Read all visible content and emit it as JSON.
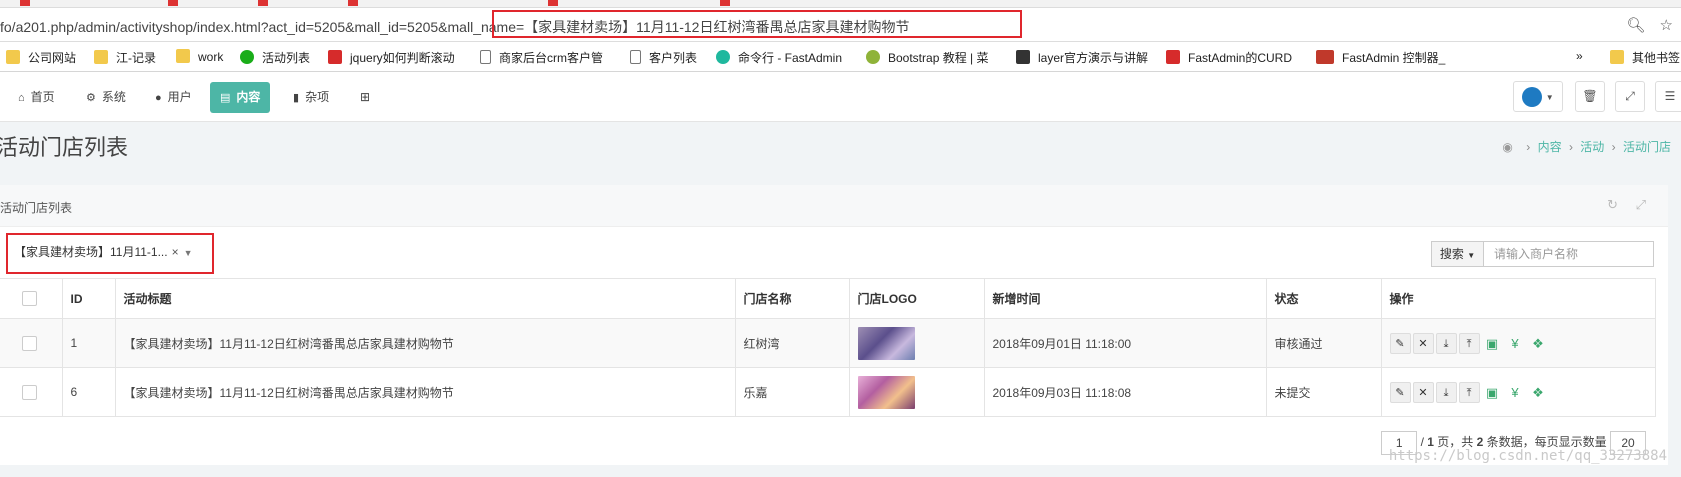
{
  "browser": {
    "url": "fo/a201.php/admin/activityshop/index.html?act_id=5205&mall_id=5205&mall_name=【家具建材卖场】11月11-12日红树湾番禺总店家具建材购物节"
  },
  "bookmarks": [
    {
      "label": "公司网站",
      "icon": "folder-icon"
    },
    {
      "label": "江-记录",
      "icon": "folder-icon"
    },
    {
      "label": "work",
      "icon": "folder-icon"
    },
    {
      "label": "活动列表",
      "icon": "green-circle-icon"
    },
    {
      "label": "jquery如何判断滚动",
      "icon": "red-logo-icon"
    },
    {
      "label": "商家后台crm客户管",
      "icon": "page-icon"
    },
    {
      "label": "客户列表",
      "icon": "page-icon"
    },
    {
      "label": "命令行 - FastAdmin",
      "icon": "teal-logo-icon"
    },
    {
      "label": "Bootstrap 教程 | 菜",
      "icon": "olive-logo-icon"
    },
    {
      "label": "layer官方演示与讲解",
      "icon": "dark-logo-icon"
    },
    {
      "label": "FastAdmin的CURD",
      "icon": "red-logo-icon"
    },
    {
      "label": "FastAdmin 控制器_",
      "icon": "w3c-logo-icon"
    },
    {
      "label": "»",
      "icon": ""
    },
    {
      "label": "其他书签",
      "icon": "folder-icon"
    }
  ],
  "nav": {
    "items": [
      {
        "label": "首页",
        "icon": "home-icon"
      },
      {
        "label": "系统",
        "icon": "gear-icon"
      },
      {
        "label": "用户",
        "icon": "user-icon"
      },
      {
        "label": "内容",
        "icon": "content-icon",
        "active": true
      },
      {
        "label": "杂项",
        "icon": "book-icon"
      }
    ]
  },
  "header": {
    "title": "活动门店列表",
    "breadcrumb": [
      "内容",
      "活动",
      "活动门店"
    ]
  },
  "panel": {
    "title": "活动门店列表",
    "filter_value": "【家具建材卖场】11月11-1...",
    "search_button": "搜索",
    "search_placeholder": "请输入商户名称"
  },
  "table": {
    "columns": [
      "ID",
      "活动标题",
      "门店名称",
      "门店LOGO",
      "新增时间",
      "状态",
      "操作"
    ],
    "rows": [
      {
        "id": "1",
        "title": "【家具建材卖场】11月11-12日红树湾番禺总店家具建材购物节",
        "shop": "红树湾",
        "time": "2018年09月01日 11:18:00",
        "status": "审核通过"
      },
      {
        "id": "6",
        "title": "【家具建材卖场】11月11-12日红树湾番禺总店家具建材购物节",
        "shop": "乐嘉",
        "time": "2018年09月03日 11:18:08",
        "status": "未提交"
      }
    ]
  },
  "pager": {
    "page": "1",
    "total_pages": "1",
    "total_items": "2",
    "page_size": "20",
    "text_a": "/ ",
    "text_b": " 页，共 ",
    "text_c": " 条数据，每页显示数量"
  },
  "watermark": "https://blog.csdn.net/qq_33273884",
  "colors": {
    "accent": "#4db6a6",
    "highlight_border": "#e0262d"
  }
}
